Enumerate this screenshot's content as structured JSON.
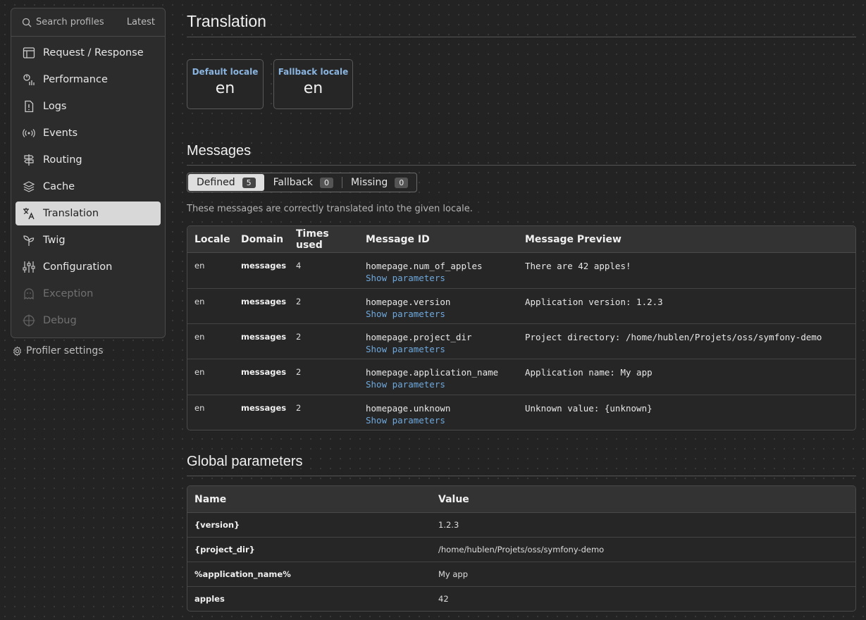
{
  "sidebar": {
    "search_placeholder": "Search profiles",
    "latest_label": "Latest",
    "items": [
      {
        "label": "Request / Response",
        "icon": "request-icon"
      },
      {
        "label": "Performance",
        "icon": "performance-icon"
      },
      {
        "label": "Logs",
        "icon": "logs-icon"
      },
      {
        "label": "Events",
        "icon": "events-icon"
      },
      {
        "label": "Routing",
        "icon": "routing-icon"
      },
      {
        "label": "Cache",
        "icon": "cache-icon"
      },
      {
        "label": "Translation",
        "icon": "translation-icon"
      },
      {
        "label": "Twig",
        "icon": "twig-icon"
      },
      {
        "label": "Configuration",
        "icon": "configuration-icon"
      },
      {
        "label": "Exception",
        "icon": "exception-icon"
      },
      {
        "label": "Debug",
        "icon": "debug-icon"
      }
    ],
    "active_item": "Translation",
    "settings_label": "Profiler settings"
  },
  "page": {
    "title": "Translation",
    "metrics": [
      {
        "label": "Default locale",
        "value": "en"
      },
      {
        "label": "Fallback locale",
        "value": "en"
      }
    ]
  },
  "messages": {
    "heading": "Messages",
    "tabs": [
      {
        "label": "Defined",
        "count": "5"
      },
      {
        "label": "Fallback",
        "count": "0"
      },
      {
        "label": "Missing",
        "count": "0"
      }
    ],
    "description": "These messages are correctly translated into the given locale.",
    "columns": [
      "Locale",
      "Domain",
      "Times used",
      "Message ID",
      "Message Preview"
    ],
    "show_parameters_label": "Show parameters",
    "rows": [
      {
        "locale": "en",
        "domain": "messages",
        "times_used": "4",
        "id": "homepage.num_of_apples",
        "preview": "There are 42 apples!"
      },
      {
        "locale": "en",
        "domain": "messages",
        "times_used": "2",
        "id": "homepage.version",
        "preview": "Application version: 1.2.3"
      },
      {
        "locale": "en",
        "domain": "messages",
        "times_used": "2",
        "id": "homepage.project_dir",
        "preview": "Project directory: /home/hublen/Projets/oss/symfony-demo"
      },
      {
        "locale": "en",
        "domain": "messages",
        "times_used": "2",
        "id": "homepage.application_name",
        "preview": "Application name: My app"
      },
      {
        "locale": "en",
        "domain": "messages",
        "times_used": "2",
        "id": "homepage.unknown",
        "preview": "Unknown value: {unknown}"
      }
    ]
  },
  "global_parameters": {
    "heading": "Global parameters",
    "columns": [
      "Name",
      "Value"
    ],
    "rows": [
      {
        "name": "{version}",
        "value": "1.2.3"
      },
      {
        "name": "{project_dir}",
        "value": "/home/hublen/Projets/oss/symfony-demo"
      },
      {
        "name": "%application_name%",
        "value": "My app"
      },
      {
        "name": "apples",
        "value": "42"
      }
    ]
  }
}
